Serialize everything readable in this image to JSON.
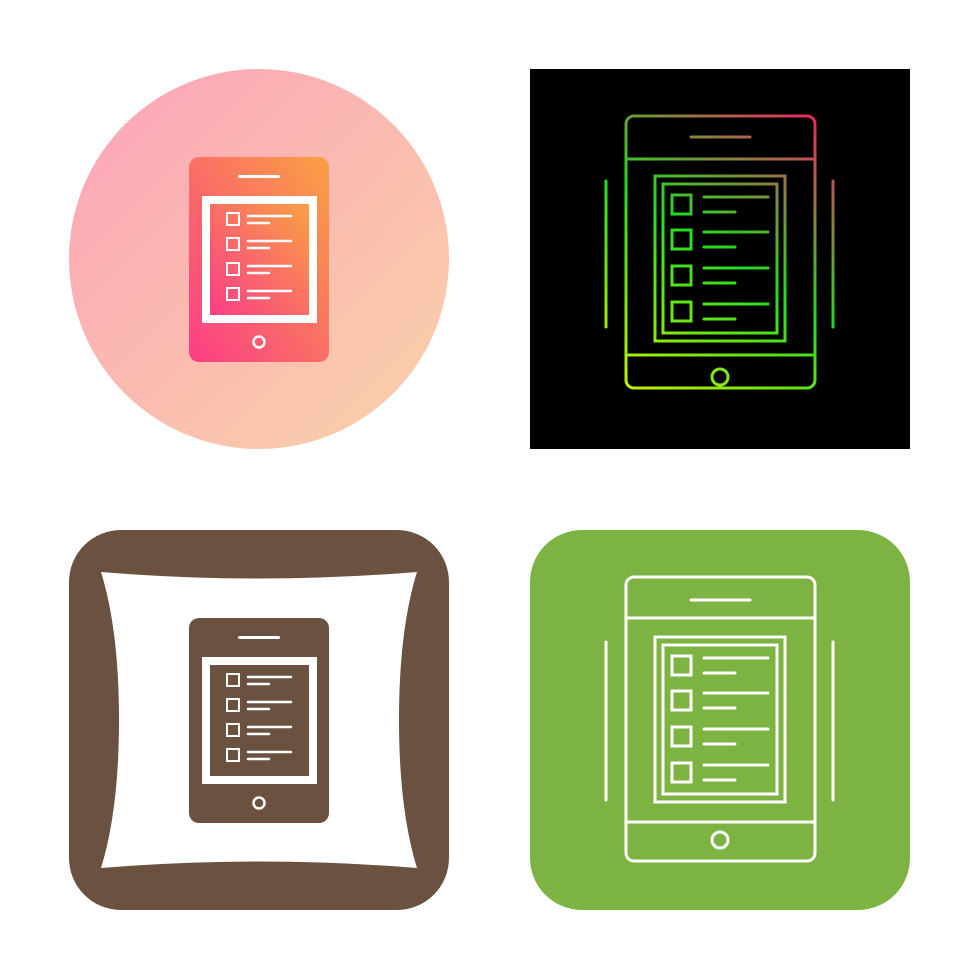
{
  "icons": [
    {
      "variant": "gradient-circle",
      "icon_name": "tablet-checklist-icon",
      "colors": {
        "bg_start": "#FCA3B9",
        "bg_end": "#F9D2A8",
        "fg_start": "#F9A144",
        "fg_end": "#FB3D86",
        "inner": "#FFFFFF"
      }
    },
    {
      "variant": "gradient-outline-on-black",
      "icon_name": "tablet-checklist-icon",
      "colors": {
        "bg": "#000000",
        "stroke_start": "#C4F000",
        "stroke_mid": "#22DD22",
        "stroke_end": "#F02660"
      }
    },
    {
      "variant": "glyph-on-pillow",
      "icon_name": "tablet-checklist-icon",
      "colors": {
        "bg": "#6B5140",
        "pillow": "#FFFFFF",
        "fg": "#6B5140"
      }
    },
    {
      "variant": "outline-on-green",
      "icon_name": "tablet-checklist-icon",
      "colors": {
        "bg": "#7CB342",
        "stroke": "#FFFFFF"
      }
    }
  ]
}
